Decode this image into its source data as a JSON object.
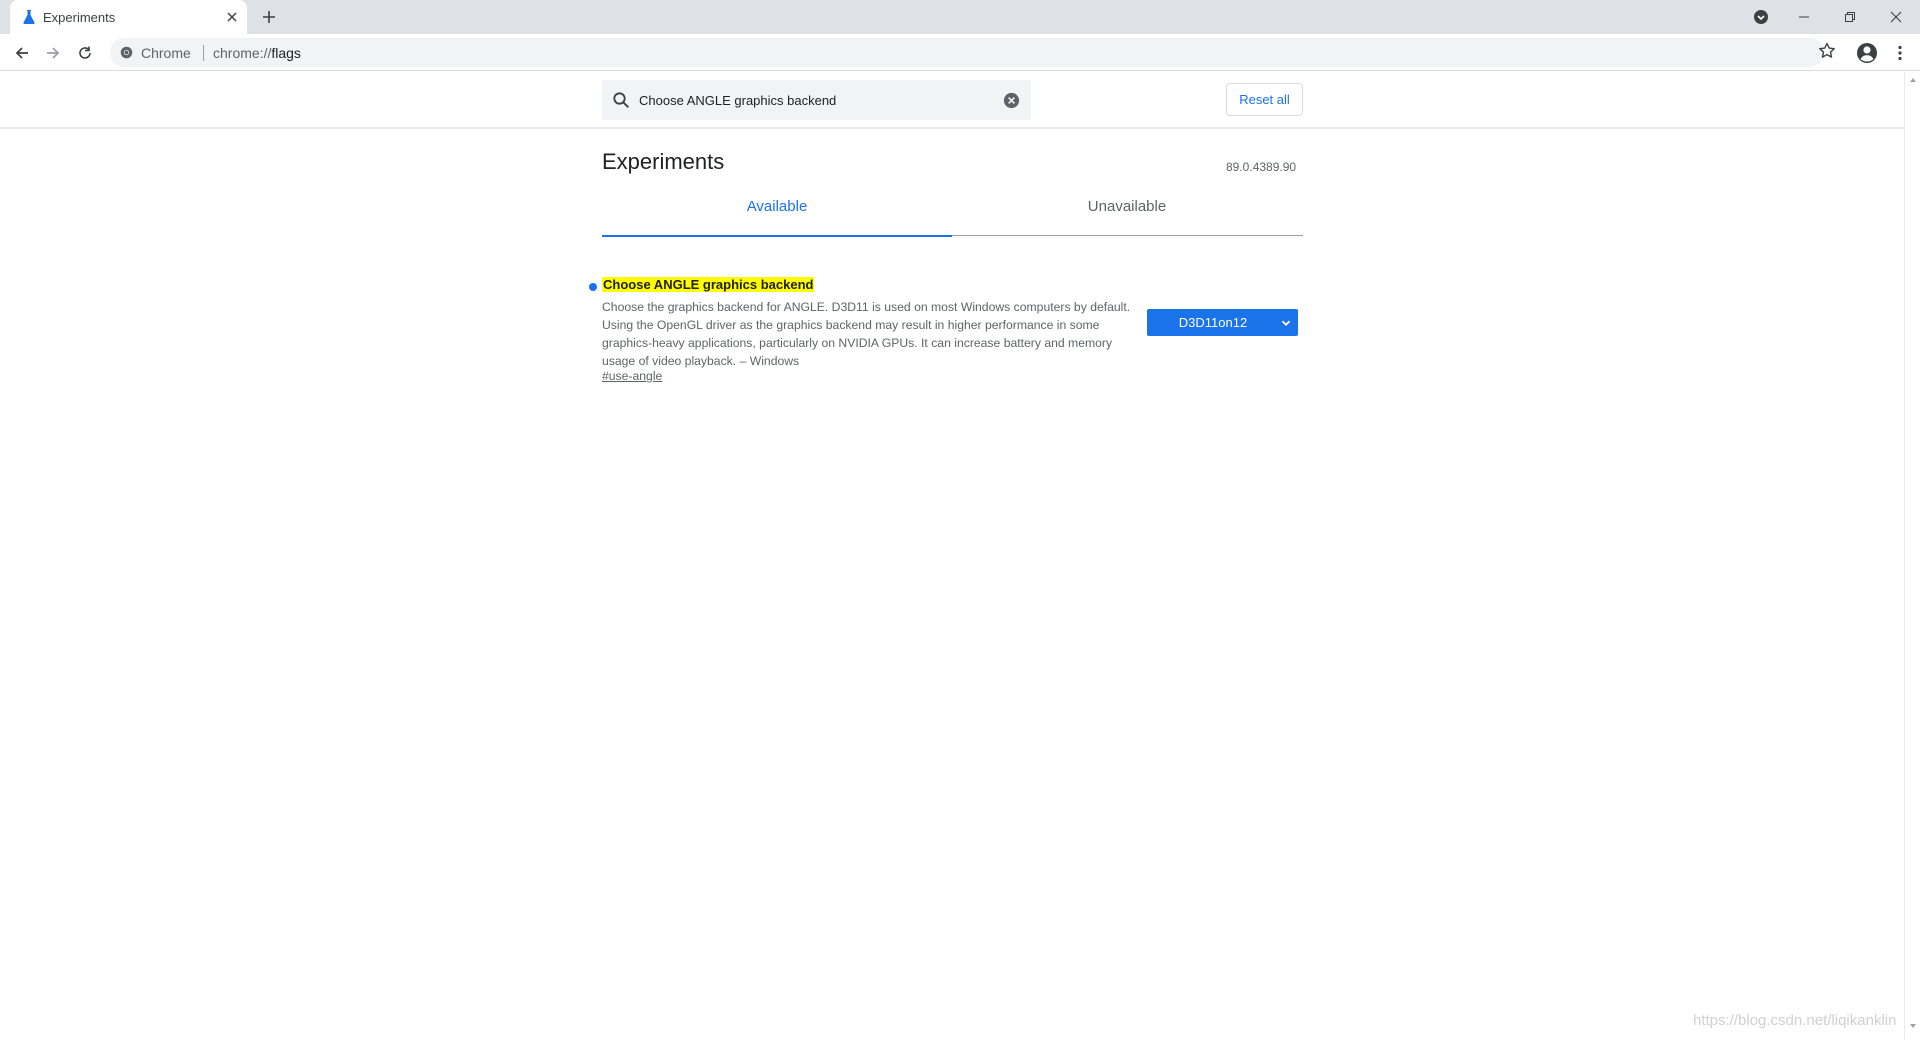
{
  "browser": {
    "tab": {
      "title": "Experiments",
      "icon": "flask-icon"
    },
    "site_chip": "Chrome",
    "url_scheme": "chrome://",
    "url_host": "flags"
  },
  "search": {
    "value": "Choose ANGLE graphics backend",
    "placeholder": "Search flags"
  },
  "reset_label": "Reset all",
  "heading": "Experiments",
  "version": "89.0.4389.90",
  "tabs": [
    {
      "label": "Available",
      "active": true
    },
    {
      "label": "Unavailable",
      "active": false
    }
  ],
  "experiment": {
    "title": "Choose ANGLE graphics backend",
    "description": "Choose the graphics backend for ANGLE. D3D11 is used on most Windows computers by default. Using the OpenGL driver as the graphics backend may result in higher performance in some graphics-heavy applications, particularly on NVIDIA GPUs. It can increase battery and memory usage of video playback. – Windows",
    "link": "#use-angle",
    "selected_option": "D3D11on12"
  },
  "watermark": "https://blog.csdn.net/liqikanklin",
  "colors": {
    "accent": "#1a73e8",
    "highlight": "#ffff00",
    "tabstrip": "#dee1e6"
  }
}
